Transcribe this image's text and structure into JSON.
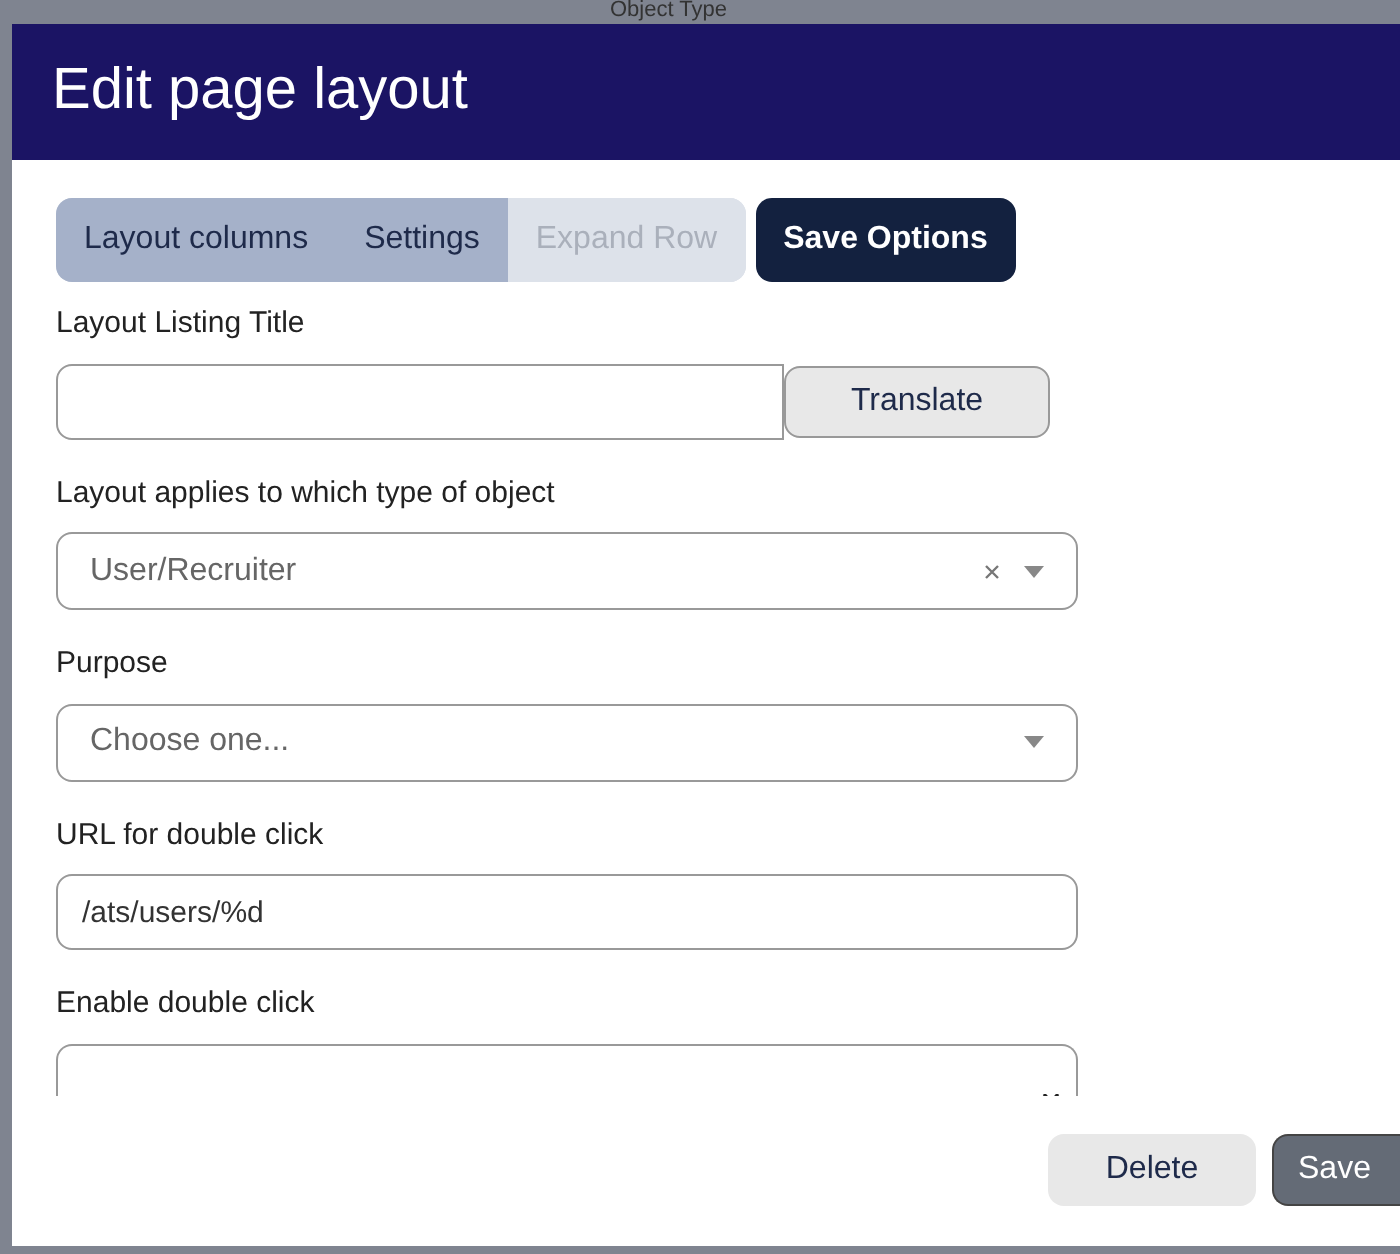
{
  "background": {
    "text": "Object Type"
  },
  "dialog": {
    "title": "Edit page layout"
  },
  "tabs": [
    {
      "label": "Layout columns",
      "disabled": false
    },
    {
      "label": "Settings",
      "disabled": false
    },
    {
      "label": "Expand Row",
      "disabled": true
    }
  ],
  "save_options": "Save Options",
  "fields": [
    {
      "kind": "text",
      "label": "Layout Listing Title",
      "button": "Translate"
    },
    {
      "kind": "select",
      "label": "Layout applies to which type of object",
      "value": "User/Recruiter",
      "clearable": true
    },
    {
      "kind": "select",
      "label": "Purpose",
      "placeholder": "Choose one...",
      "clearable": false
    },
    {
      "kind": "text",
      "label": "URL for double click",
      "value": "/ats/users/%d"
    },
    {
      "kind": "cutselect",
      "label": "Enable double click"
    }
  ],
  "footer": {
    "buttons": [
      {
        "label": "Delete",
        "kind": "secondary"
      },
      {
        "label": "Save",
        "kind": "primary"
      }
    ]
  }
}
